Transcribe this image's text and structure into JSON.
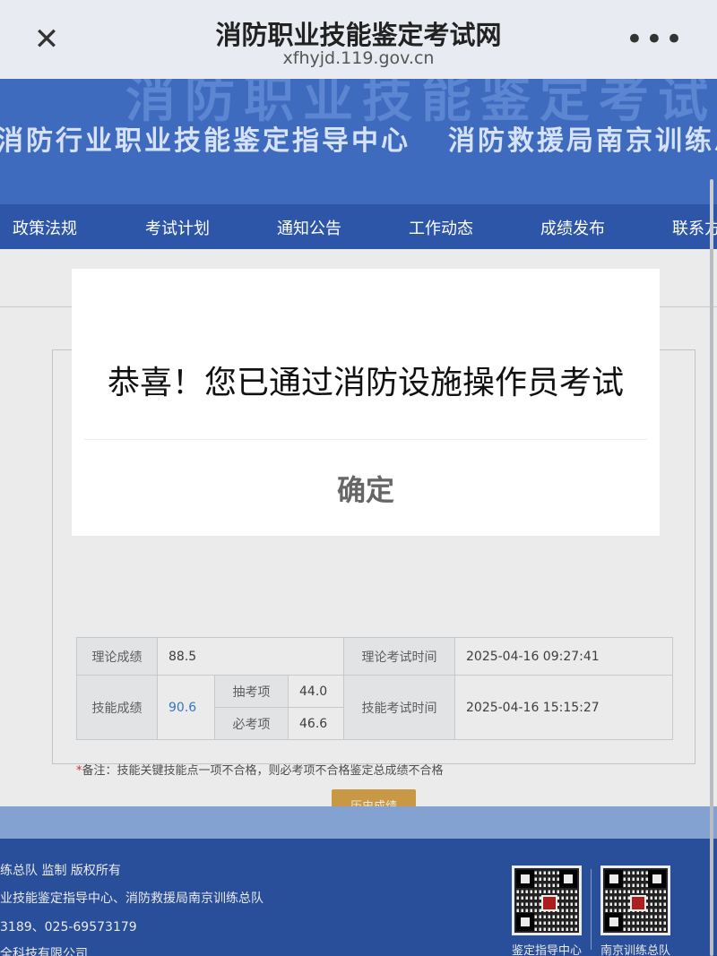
{
  "topbar": {
    "title": "消防职业技能鉴定考试网",
    "url": "xfhyjd.119.gov.cn",
    "close_icon": "✕",
    "more_icon": "•••"
  },
  "banner": {
    "big": "消防职业技能鉴定考试网",
    "sub1": "消防行业职业技能鉴定指导中心",
    "sub2": "消防救援局南京训练总"
  },
  "nav": [
    "政策法规",
    "考试计划",
    "通知公告",
    "工作动态",
    "成绩发布",
    "联系方"
  ],
  "scores": {
    "theory_label": "理论成绩",
    "theory_value": "88.5",
    "theory_time_label": "理论考试时间",
    "theory_time": "2025-04-16 09:27:41",
    "skill_label": "技能成绩",
    "skill_value": "90.6",
    "draw_label": "抽考项",
    "draw_value": "44.0",
    "required_label": "必考项",
    "required_value": "46.6",
    "skill_time_label": "技能考试时间",
    "skill_time": "2025-04-16 15:15:27"
  },
  "note": {
    "star": "*",
    "text": "备注：技能关键技能点一项不合格，则必考项不合格鉴定总成绩不合格"
  },
  "history_button": "历史成绩",
  "modal": {
    "message": "恭喜！您已通过消防设施操作员考试",
    "ok": "确定"
  },
  "footer": {
    "line1": "练总队 监制 版权所有",
    "line2": "业技能鉴定指导中心、消防救援局南京训练总队",
    "line3": "3189、025-69573179",
    "line4": "全科技有限公司",
    "qr1_label": "鉴定指导中心",
    "qr2_label": "南京训练总队"
  },
  "colors": {
    "banner": "#3f6bbf",
    "nav": "#2d55a8",
    "button": "#d9a54a",
    "link": "#3b7fd0"
  }
}
